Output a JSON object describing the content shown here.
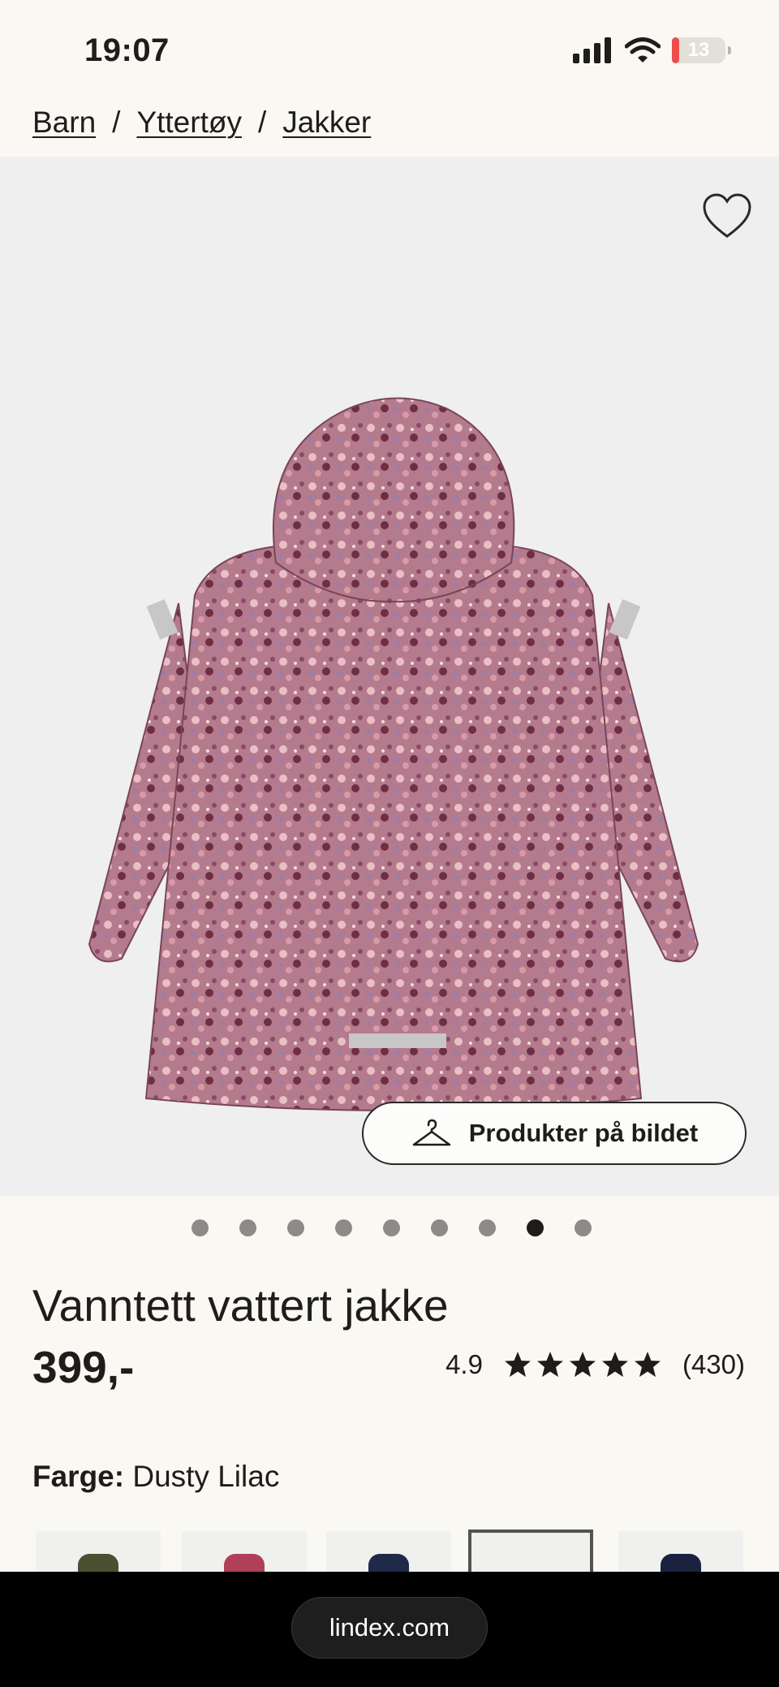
{
  "status_bar": {
    "time": "19:07",
    "battery_level": "13",
    "battery_fraction": 0.13,
    "signal_icon": "cellular-signal-icon",
    "wifi_icon": "wifi-icon"
  },
  "breadcrumb": {
    "items": [
      "Barn",
      "Yttertøy",
      "Jakker"
    ],
    "separator": "/"
  },
  "hero": {
    "favorite_icon": "heart-outline-icon",
    "products_button_label": "Produkter på bildet",
    "products_button_icon": "hanger-icon"
  },
  "carousel": {
    "total_images": 9,
    "active_index": 7
  },
  "product": {
    "title": "Vanntett vattert jakke",
    "price": "399,-",
    "rating_value": "4.9",
    "rating_stars": 5,
    "review_count": "(430)"
  },
  "color": {
    "label": "Farge:",
    "value": "Dusty Lilac",
    "swatch_colors": [
      "#4a5030",
      "#b0405a",
      "#1f2a48",
      "#b08a9c",
      "#1a2240"
    ],
    "selected_swatch": 3
  },
  "browser": {
    "url": "lindex.com"
  },
  "colors": {
    "background": "#faf8f3",
    "text": "#1f1d1a",
    "hero_background": "#efefef",
    "jacket": "#b47b8e",
    "battery_low": "#eb4d4b"
  }
}
